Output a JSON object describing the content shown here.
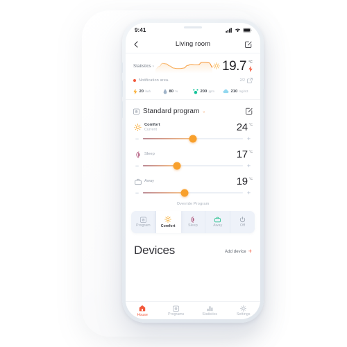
{
  "status_bar": {
    "time": "9:41",
    "icons": [
      "cellular-signal-icon",
      "wifi-icon",
      "battery-icon"
    ]
  },
  "nav": {
    "back_icon": "chevron-left-icon",
    "title": "Living room",
    "edit_icon": "edit-square-icon"
  },
  "statistics": {
    "link_label": "Statistics",
    "link_chevron": "›",
    "weather_icon": "sun-icon",
    "temperature": "19.7",
    "unit": "°C",
    "bolt_icon": "lightning-bolt-icon",
    "notification_text": "Notification area.",
    "notification_count": "2/2",
    "external_link_icon": "external-link-icon",
    "metrics": [
      {
        "icon": "lightning-bolt-icon",
        "value": "20",
        "unit": "kwh",
        "color": "#f9a825"
      },
      {
        "icon": "humidity-drop-icon",
        "value": "80",
        "unit": "%",
        "color": "#9fb3c8"
      },
      {
        "icon": "co2-molecule-icon",
        "value": "200",
        "unit": "ppm",
        "color": "#15c39a"
      },
      {
        "icon": "cloud-dust-icon",
        "value": "210",
        "unit": "mg/m3",
        "color": "#93d8ef"
      }
    ]
  },
  "program": {
    "icon": "calendar-program-icon",
    "name": "Standard program",
    "chevron": "⌄",
    "edit_icon": "edit-square-icon",
    "override_label": "Override Program",
    "setpoints": [
      {
        "icon": "sun-icon",
        "name": "Comfort",
        "sub": "Current",
        "temp": "24",
        "unit": "°C",
        "percent": 50,
        "minus": "−",
        "plus": "+"
      },
      {
        "icon": "moon-icon",
        "name": "Sleep",
        "sub": "",
        "temp": "17",
        "unit": "°C",
        "percent": 34,
        "minus": "−",
        "plus": "+"
      },
      {
        "icon": "briefcase-icon",
        "name": "Away",
        "sub": "",
        "temp": "19",
        "unit": "°C",
        "percent": 42,
        "minus": "−",
        "plus": "+"
      }
    ]
  },
  "mode_bar": {
    "selected": "Comfort",
    "items": [
      {
        "label": "Program",
        "icon": "calendar-program-icon",
        "color": "#aab3c0",
        "active": false
      },
      {
        "label": "Comfort",
        "icon": "sun-icon",
        "color": "#f5a623",
        "active": true
      },
      {
        "label": "Sleep",
        "icon": "moon-icon",
        "color": "#a6416a",
        "active": false
      },
      {
        "label": "Away",
        "icon": "briefcase-icon",
        "color": "#21c08b",
        "active": false
      },
      {
        "label": "Off",
        "icon": "power-icon",
        "color": "#98a1ad",
        "active": false
      }
    ]
  },
  "devices": {
    "title": "Devices",
    "add_label": "Add device",
    "add_plus": "+"
  },
  "tab_bar": {
    "selected": "House",
    "items": [
      {
        "label": "House",
        "icon": "home-icon",
        "active": true
      },
      {
        "label": "Programs",
        "icon": "calendar-icon",
        "active": false
      },
      {
        "label": "Statistics",
        "icon": "bar-chart-icon",
        "active": false
      },
      {
        "label": "Settings",
        "icon": "gear-icon",
        "active": false
      }
    ]
  },
  "colors": {
    "accent_orange": "#f8a02c",
    "accent_red": "#f2593c",
    "text_dark": "#26262b",
    "text_muted": "#a6aeb9",
    "bezel": "#e7ecf1"
  },
  "chart_data": {
    "type": "line",
    "title": "Statistics sparkline",
    "x": [
      0,
      1,
      2,
      3,
      4,
      5,
      6,
      7,
      8,
      9,
      10,
      11,
      12,
      13,
      14,
      15,
      16
    ],
    "values": [
      4,
      9,
      15,
      14,
      10,
      6,
      5,
      5,
      6,
      11,
      13,
      12,
      12,
      17,
      17,
      16,
      8
    ],
    "ylim": [
      0,
      20
    ],
    "xlabel": "",
    "ylabel": "",
    "grid": false,
    "legend": "none"
  }
}
